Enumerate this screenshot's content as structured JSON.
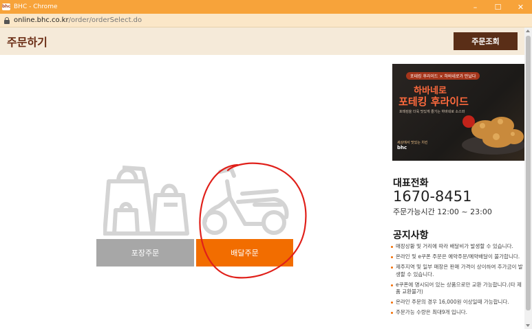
{
  "window": {
    "title": "BHC - Chrome",
    "favicon_text": "bhc",
    "controls": [
      "–",
      "☐",
      "✕"
    ]
  },
  "address_bar": {
    "domain": "online.bhc.co.kr",
    "path": "/order/orderSelect.do"
  },
  "header": {
    "title": "주문하기",
    "order_check_label": "주문조회"
  },
  "order_options": {
    "pickup_label": "포장주문",
    "delivery_label": "배달주문"
  },
  "banner": {
    "tag": "포테킹 후라이드 × 하바네로가 만났다",
    "title_line1": "하바네로",
    "title_line2": "포테킹 후라이드",
    "subtitle": "포테킹을 더욱 맛있게 즐기는 하바네로 소스와",
    "logo_text": "세상에서 맛있는 치킨",
    "logo_brand": "bhc"
  },
  "contact": {
    "title": "대표전화",
    "phone": "1670-8451",
    "hours": "주문가능시간 12:00 ~ 23:00"
  },
  "notices": {
    "title": "공지사항",
    "items": [
      "매장상황 및 거리에 따라 배달비가 발생할 수 있습니다.",
      "온라인 및 e쿠폰 주문은 예약주문/예약배달이 불가합니다.",
      "제주지역 및 일부 매장은 판매 가격이 상이하여 추가금이 발생할 수 있습니다.",
      "e쿠폰에 명시되어 있는 상품으로만 교환 가능합니다.(타 제품 교환불가)",
      "온라인 주문의 경우 16,000원 이상일때 가능합니다.",
      "주문가능 수량은 최대9개 입니다."
    ]
  },
  "colors": {
    "titlebar": "#f7a33a",
    "header_bg": "#f5ead9",
    "brand_brown": "#5a2e17",
    "delivery_orange": "#f26d00",
    "pickup_gray": "#a7a7a7",
    "scribble_red": "#e0201a"
  },
  "icons": {
    "pickup": "shopping-bags-icon",
    "delivery": "scooter-icon",
    "lock": "lock-icon"
  }
}
